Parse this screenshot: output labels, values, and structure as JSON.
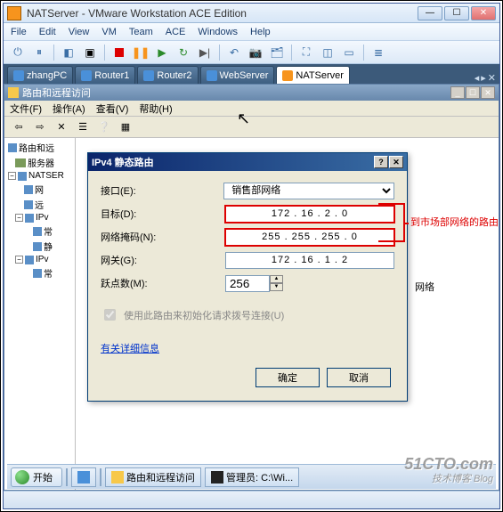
{
  "vmware": {
    "title": "NATServer - VMware Workstation ACE Edition",
    "menu": [
      "File",
      "Edit",
      "View",
      "VM",
      "Team",
      "ACE",
      "Windows",
      "Help"
    ],
    "tabs": [
      {
        "label": "zhangPC",
        "active": false
      },
      {
        "label": "Router1",
        "active": false
      },
      {
        "label": "Router2",
        "active": false
      },
      {
        "label": "WebServer",
        "active": false
      },
      {
        "label": "NATServer",
        "active": true
      }
    ]
  },
  "route_window": {
    "title": "路由和远程访问",
    "menu": [
      "文件(F)",
      "操作(A)",
      "查看(V)",
      "帮助(H)"
    ],
    "tree": {
      "root": "路由和远",
      "server_root": "服务器",
      "server": "NATSER",
      "nodes": [
        "网",
        "远",
        "IPv",
        "常",
        "静",
        "IPv",
        "常"
      ]
    }
  },
  "dialog": {
    "title": "IPv4 静态路由",
    "fields": {
      "interface_label": "接口(E):",
      "interface_value": "销售部网络",
      "target_label": "目标(D):",
      "target_value": "172 . 16 .  2 .  0",
      "mask_label": "网络掩码(N):",
      "mask_value": "255 . 255 . 255 .  0",
      "gateway_label": "网关(G):",
      "gateway_value": "172 . 16 .  1 .  2",
      "hops_label": "跃点数(M):",
      "hops_value": "256"
    },
    "checkbox_label": "使用此路由来初始化请求拨号连接(U)",
    "link": "有关详细信息",
    "ok": "确定",
    "cancel": "取消"
  },
  "behind_text": "网络",
  "annotation": "到市场部网络的路由",
  "taskbar": {
    "start": "开始",
    "items": [
      {
        "label": "路由和远程访问"
      },
      {
        "label": "管理员: C:\\Wi..."
      }
    ]
  },
  "watermark": {
    "main": "51CTO.com",
    "sub": "技术博客  Blog"
  }
}
